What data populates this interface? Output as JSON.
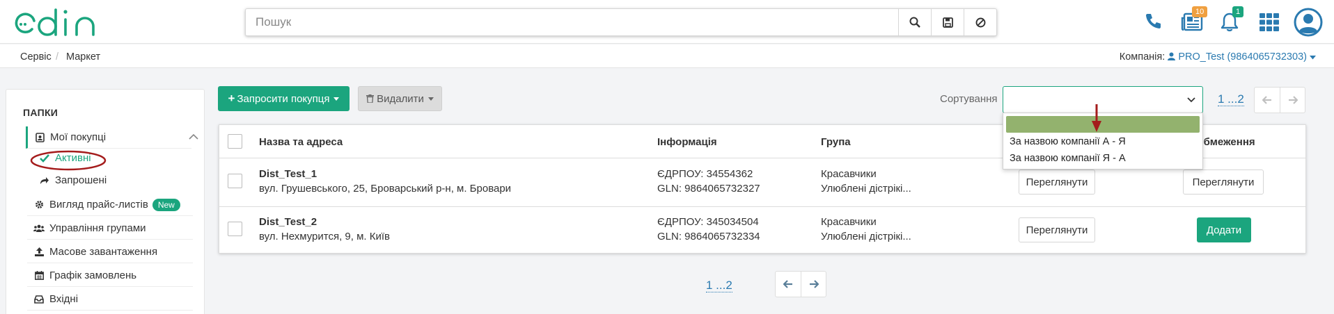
{
  "header": {
    "logo_text": "edin",
    "search_placeholder": "Пошук",
    "news_badge": "10",
    "notifications_badge": "1",
    "colors": {
      "brand": "#1ba57e",
      "news_badge": "#f0a040",
      "notify_badge": "#1ba57e",
      "icon_blue": "#2a7ab0"
    }
  },
  "breadcrumb": {
    "items": [
      "Сервіс",
      "Маркет"
    ],
    "separator": "/"
  },
  "company": {
    "label": "Компанія:",
    "value": "PRO_Test (9864065732303)"
  },
  "sidebar": {
    "title": "ПАПКИ",
    "my_purchases": "Мої покупці",
    "sub_active": "Активні",
    "sub_invited": "Запрошені",
    "items": [
      {
        "label": "Вигляд прайс-листів",
        "badge": "New",
        "icon": "gear-icon"
      },
      {
        "label": "Управління групами",
        "icon": "users-icon"
      },
      {
        "label": "Масове завантаження",
        "icon": "upload-icon"
      },
      {
        "label": "Графік замовлень",
        "icon": "calendar-icon"
      },
      {
        "label": "Вхідні",
        "icon": "inbox-icon"
      }
    ]
  },
  "toolbar": {
    "invite_label": "Запросити покупця",
    "delete_label": "Видалити",
    "sort_label": "Сортування",
    "sort_options": [
      "",
      "За назвою компанії А - Я",
      "За назвою компанії Я - А"
    ],
    "pager_text": "1 ...2"
  },
  "table": {
    "headers": [
      "Назва та адреса",
      "Інформація",
      "Група",
      "Обмеження"
    ],
    "rows": [
      {
        "name": "Dist_Test_1",
        "address": "вул. Грушевського, 25, Броварський р-н, м. Бровари",
        "edrpou": "ЄДРПОУ: 34554362",
        "gln": "GLN: 9864065732327",
        "group1": "Красавчики",
        "group2": "Улюблені дістрікі...",
        "view_label": "Переглянути",
        "limit_label": "Переглянути"
      },
      {
        "name": "Dist_Test_2",
        "address": "вул. Нехмурится, 9, м. Київ",
        "edrpou": "ЄДРПОУ: 345034504",
        "gln": "GLN: 9864065732334",
        "group1": "Красавчики",
        "group2": "Улюблені дістрікі...",
        "view_label": "Переглянути",
        "limit_label": "Додати"
      }
    ]
  },
  "bottom_pager": {
    "text": "1 ...2"
  }
}
